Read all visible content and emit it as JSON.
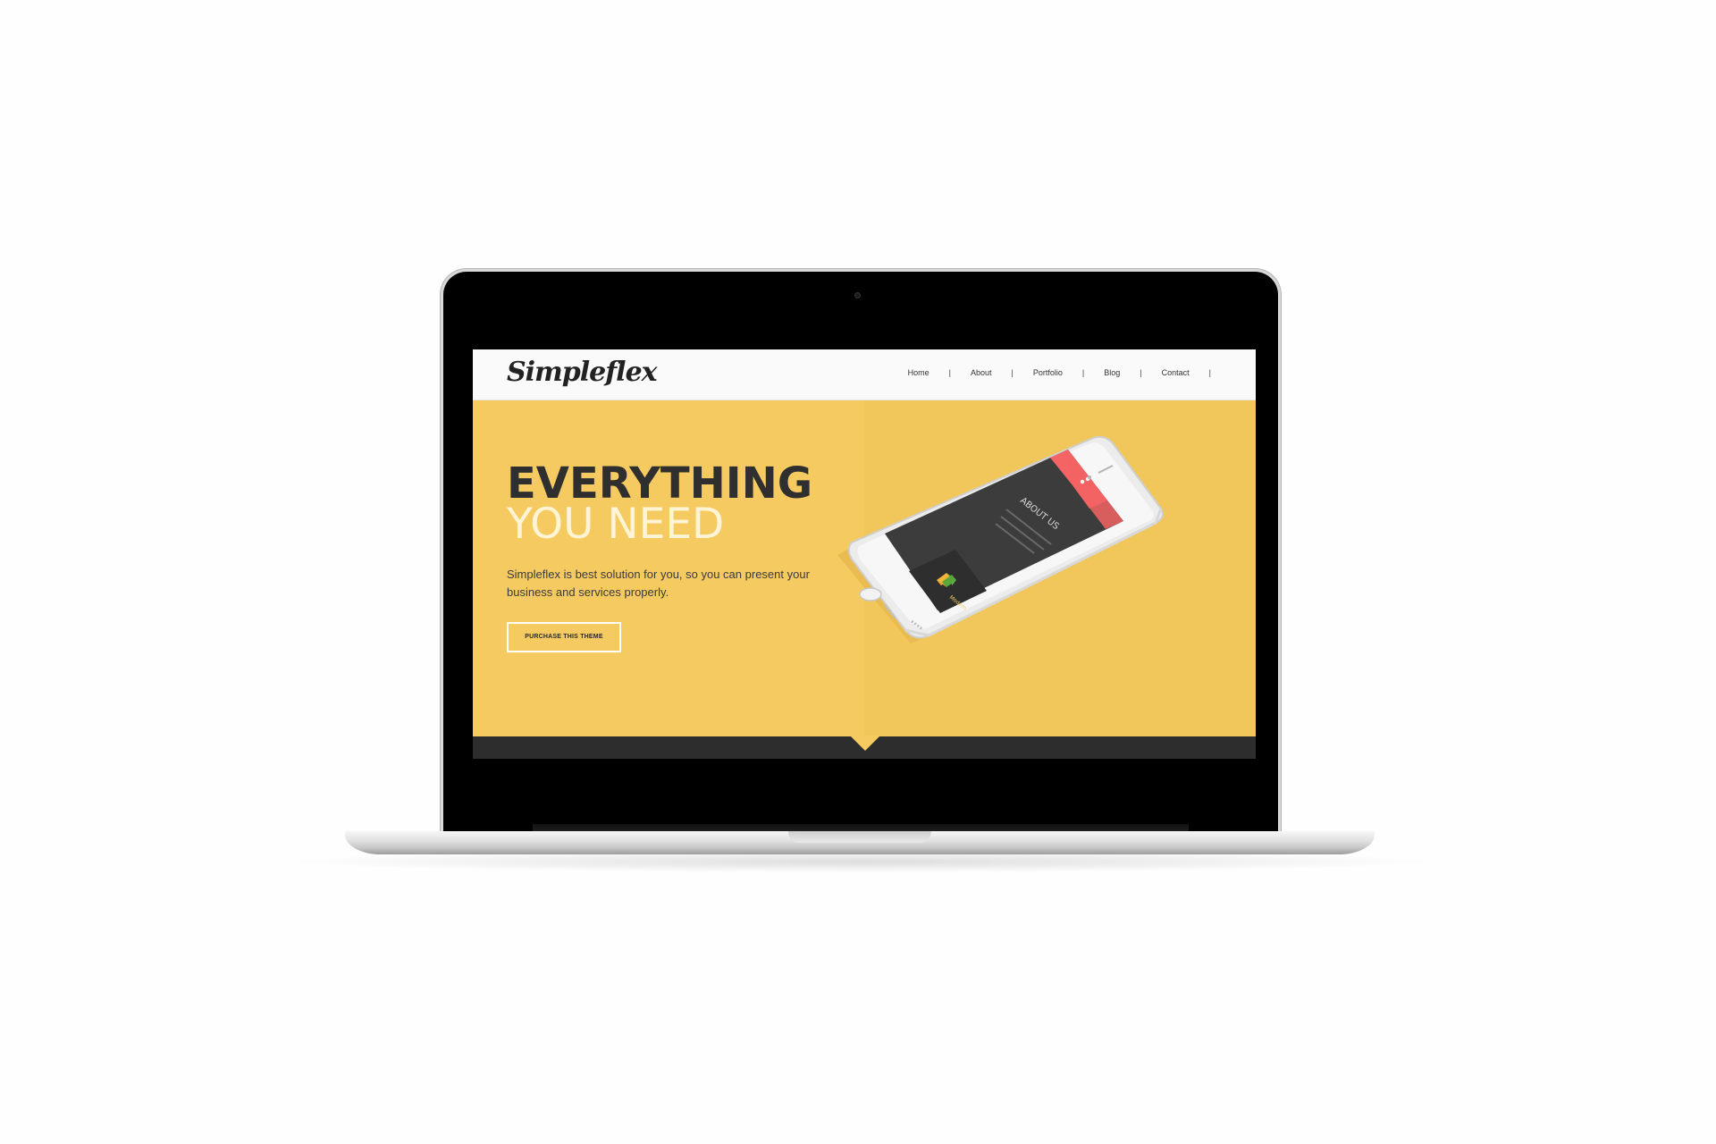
{
  "site": {
    "logo": "Simpleflex",
    "nav": {
      "items": [
        {
          "label": "Home"
        },
        {
          "label": "About"
        },
        {
          "label": "Portfolio"
        },
        {
          "label": "Blog"
        },
        {
          "label": "Contact"
        }
      ],
      "separator": "|"
    },
    "hero": {
      "headline_line1": "EVERYTHING",
      "headline_line2": "YOU NEED",
      "subtext": "Simpleflex is best solution for you, so you can present your business and services properly.",
      "cta_label": "PURCHASE THIS THEME"
    },
    "phone_screen": {
      "section_title": "ABOUT US",
      "feature_label": "Modern"
    }
  },
  "colors": {
    "hero_yellow": "#f5cb61",
    "dark_strip": "#2d2d2d",
    "phone_accent": "#f56464"
  }
}
